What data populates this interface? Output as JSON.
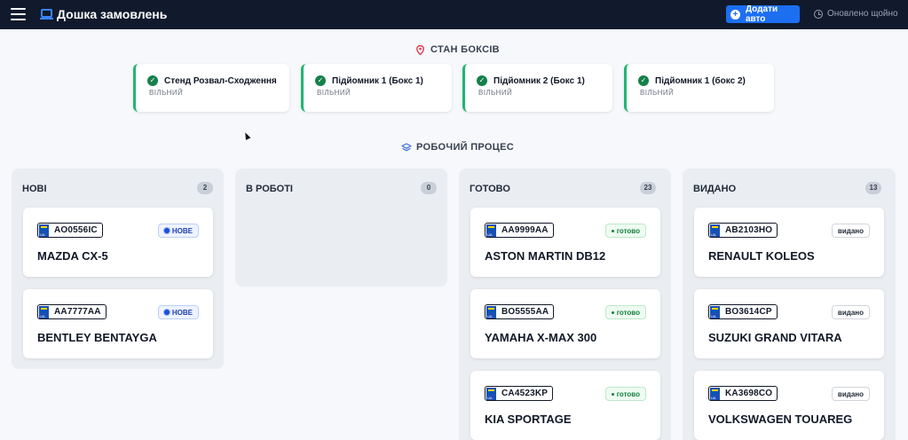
{
  "header": {
    "title": "Дошка замовлень",
    "add_button": "Додати авто",
    "update_status": "Оновлено щойно"
  },
  "bays": {
    "heading": "СТАН БОКСІВ",
    "items": [
      {
        "name": "Стенд Розвал-Сходження",
        "status": "ВІЛЬНИЙ"
      },
      {
        "name": "Підйомник 1 (Бокс 1)",
        "status": "ВІЛЬНИЙ"
      },
      {
        "name": "Підйомник 2 (Бокс 1)",
        "status": "ВІЛЬНИЙ"
      },
      {
        "name": "Підйомник 1 (бокс 2)",
        "status": "ВІЛЬНИЙ"
      }
    ]
  },
  "workflow": {
    "heading": "РОБОЧИЙ ПРОЦЕС",
    "columns": [
      {
        "title": "НОВІ",
        "count": "2",
        "cards": [
          {
            "plate": "AO0556IC",
            "car": "MAZDA CX-5",
            "status": "НОВЕ"
          },
          {
            "plate": "AA7777AA",
            "car": "BENTLEY BENTAYGA",
            "status": "НОВЕ"
          }
        ]
      },
      {
        "title": "В РОБОТІ",
        "count": "0",
        "cards": []
      },
      {
        "title": "ГОТОВО",
        "count": "23",
        "cards": [
          {
            "plate": "AA9999AA",
            "car": "ASTON MARTIN DB12",
            "status": "готово"
          },
          {
            "plate": "BO5555AA",
            "car": "YAMAHA X-MAX 300",
            "status": "готово"
          },
          {
            "plate": "CA4523KP",
            "car": "KIA SPORTAGE",
            "status": "готово"
          }
        ]
      },
      {
        "title": "ВИДАНО",
        "count": "13",
        "cards": [
          {
            "plate": "AB2103HO",
            "car": "RENAULT KOLEOS",
            "status": "видано"
          },
          {
            "plate": "BO3614CP",
            "car": "SUZUKI GRAND VITARA",
            "status": "видано"
          },
          {
            "plate": "KA3698CO",
            "car": "VOLKSWAGEN TOUAREG",
            "status": "видано"
          }
        ]
      }
    ]
  },
  "colors": {
    "topbar": "#101a2c",
    "accent": "#1d6ff2",
    "bay_free": "#22b573",
    "status_new": "#1e40af",
    "status_ready": "#15803d"
  }
}
